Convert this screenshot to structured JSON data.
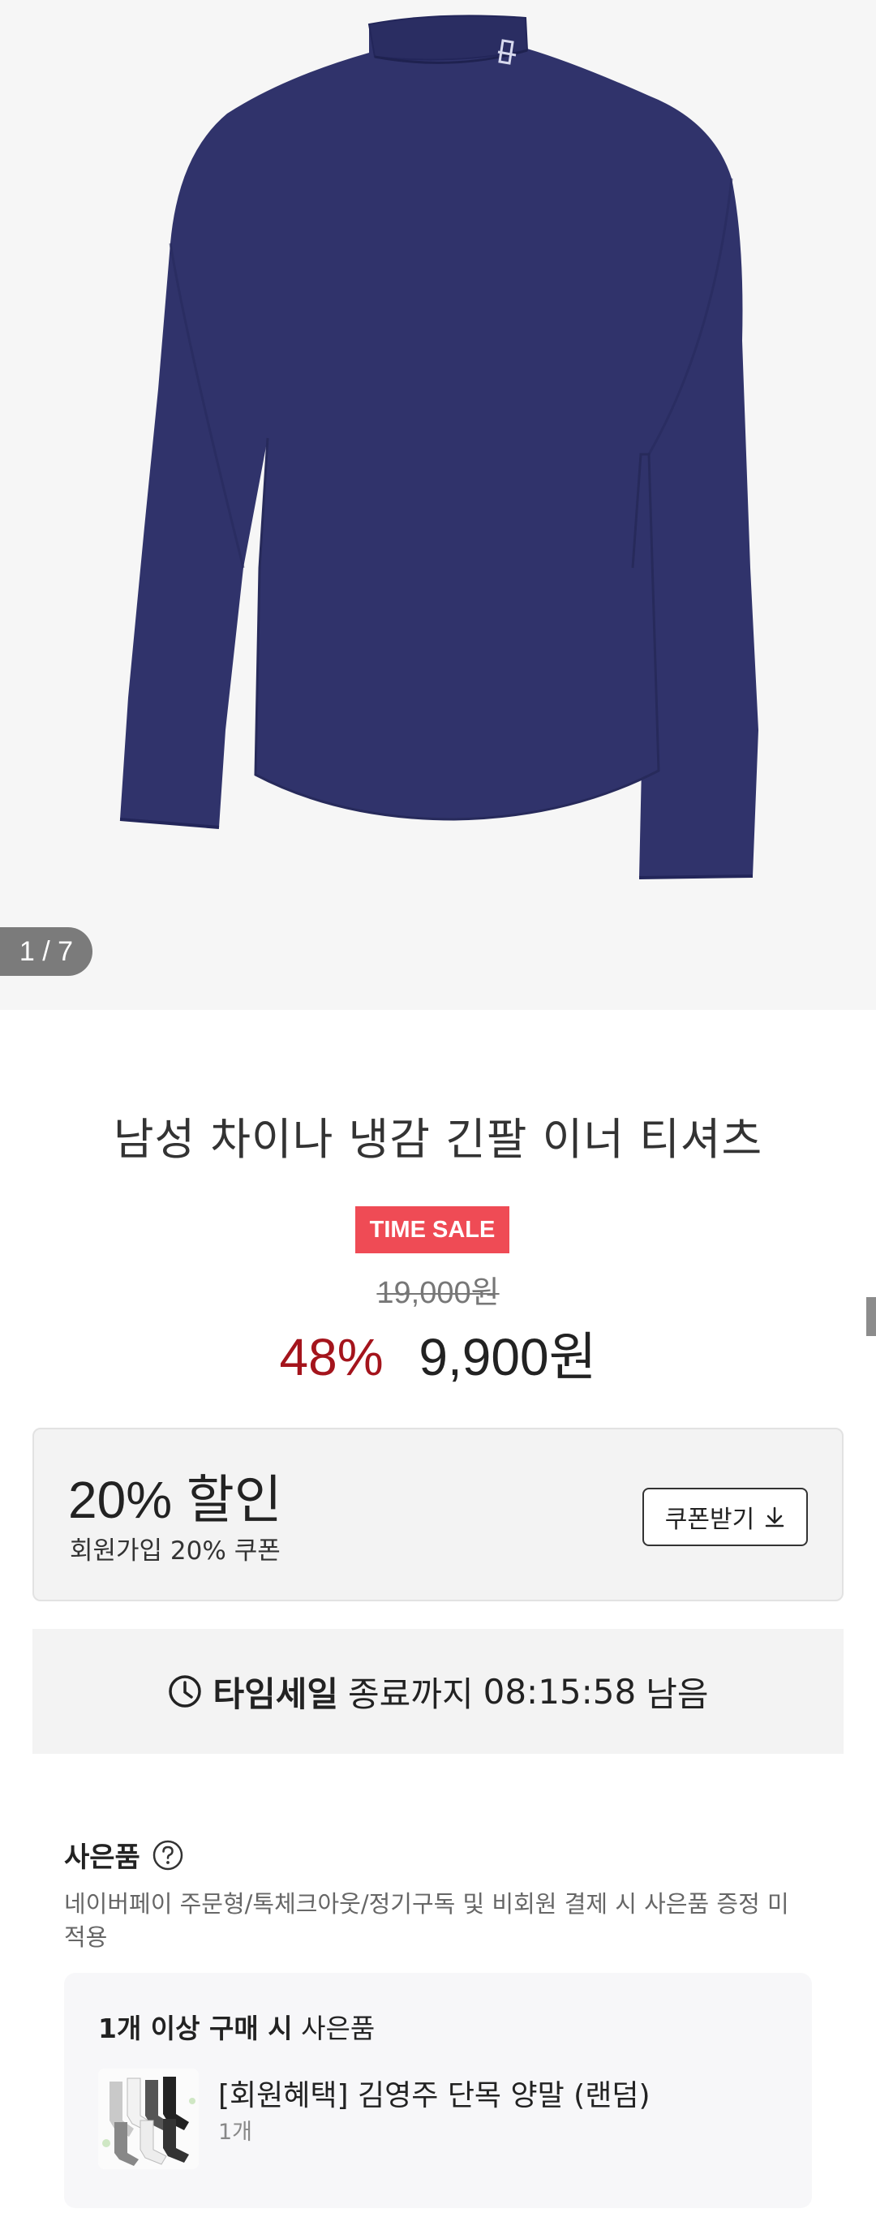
{
  "gallery": {
    "counter": "1 / 7",
    "image": "navy-mock-neck-long-sleeve-shirt"
  },
  "product": {
    "title": "남성 차이나 냉감 긴팔 이너 티셔츠",
    "badge": "TIME SALE",
    "original_price": "19,000원",
    "discount_rate": "48%",
    "final_price": "9,900원"
  },
  "coupon": {
    "title": "20% 할인",
    "subtitle": "회원가입 20% 쿠폰",
    "button_label": "쿠폰받기"
  },
  "timer": {
    "prefix": "타임세일",
    "middle": "종료까지",
    "remaining": "08:15:58",
    "suffix": "남음"
  },
  "gift": {
    "heading": "사은품",
    "note": "네이버페이 주문형/톡체크아웃/정기구독 및 비회원 결제 시 사은품 증정 미적용",
    "condition_bold": "1개 이상 구매 시",
    "condition_rest": "사은품",
    "item_name": "[회원혜택] 김영주 단목 양말 (랜덤)",
    "item_qty": "1개"
  },
  "colors": {
    "badge": "#ef4b55",
    "discount": "#a4141c",
    "shirt": "#30336b"
  }
}
